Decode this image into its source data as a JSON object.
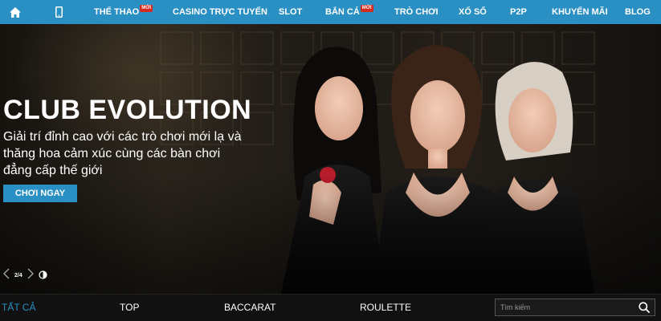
{
  "nav": {
    "items": [
      {
        "label": "THỂ THAO",
        "badge": "MỚI"
      },
      {
        "label": "CASINO TRỰC TUYẾN"
      },
      {
        "label": "SLOT"
      },
      {
        "label": "BẮN CÁ",
        "badge": "MỚI"
      },
      {
        "label": "TRÒ CHƠI"
      },
      {
        "label": "XỔ SỐ"
      },
      {
        "label": "P2P"
      },
      {
        "label": "KHUYẾN MÃI"
      },
      {
        "label": "BLOG"
      }
    ],
    "icons": [
      "home-icon",
      "mobile-phone-icon"
    ]
  },
  "hero": {
    "title": "CLUB EVOLUTION",
    "description": "Giải trí đỉnh cao với các trò chơi mới lạ và thăng hoa cảm xúc cùng các bàn chơi đẳng cấp thế giới",
    "cta_label": "CHƠI NGAY",
    "pager": {
      "current": 2,
      "total": 4,
      "text": "2/4"
    }
  },
  "filter": {
    "tabs": [
      {
        "label": "TẤT CẢ",
        "active": true
      },
      {
        "label": "TOP",
        "active": false
      },
      {
        "label": "BACCARAT",
        "active": false
      },
      {
        "label": "ROULETTE",
        "active": false
      }
    ],
    "search_placeholder": "Tìm kiếm"
  },
  "colors": {
    "accent": "#2a8fc2",
    "badge": "#d72a1f",
    "background": "#111111"
  }
}
